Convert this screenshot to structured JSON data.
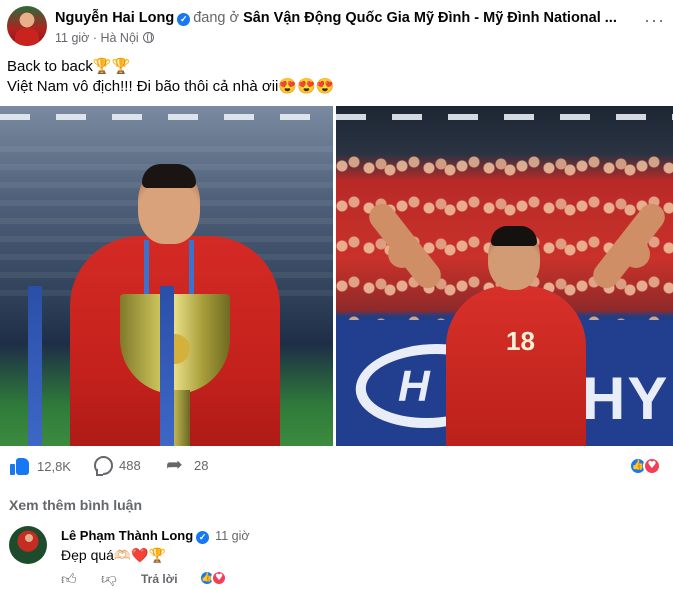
{
  "post": {
    "author": "Nguyễn Hai Long",
    "at_text": "đang ở",
    "location": "Sân Vận Động Quốc Gia Mỹ Đình - Mỹ Đình National ...",
    "time": "11 giờ",
    "place": "Hà Nội",
    "more_label": "···",
    "text_line1": "Back to back🏆🏆",
    "text_line2": "Việt Nam vô địch!!! Đi bão thôi cả nhà ơii😍😍😍",
    "images": {
      "left_icon": "trophy-photo",
      "right_icon": "celebration-photo",
      "jersey_number": "18",
      "banner_text": "HY"
    }
  },
  "stats": {
    "likes": "12,8K",
    "comments": "488",
    "shares": "28",
    "reaction_icons": [
      "like-icon",
      "love-icon"
    ]
  },
  "view_more": "Xem thêm bình luận",
  "comment": {
    "author": "Lê Phạm Thành Long",
    "time": "11 giờ",
    "text": "Đẹp quá🫶🏻❤️🏆",
    "reply_label": "Trả lời"
  },
  "colors": {
    "accent": "#1877f2",
    "love": "#f33e58",
    "muted": "#65676b"
  }
}
